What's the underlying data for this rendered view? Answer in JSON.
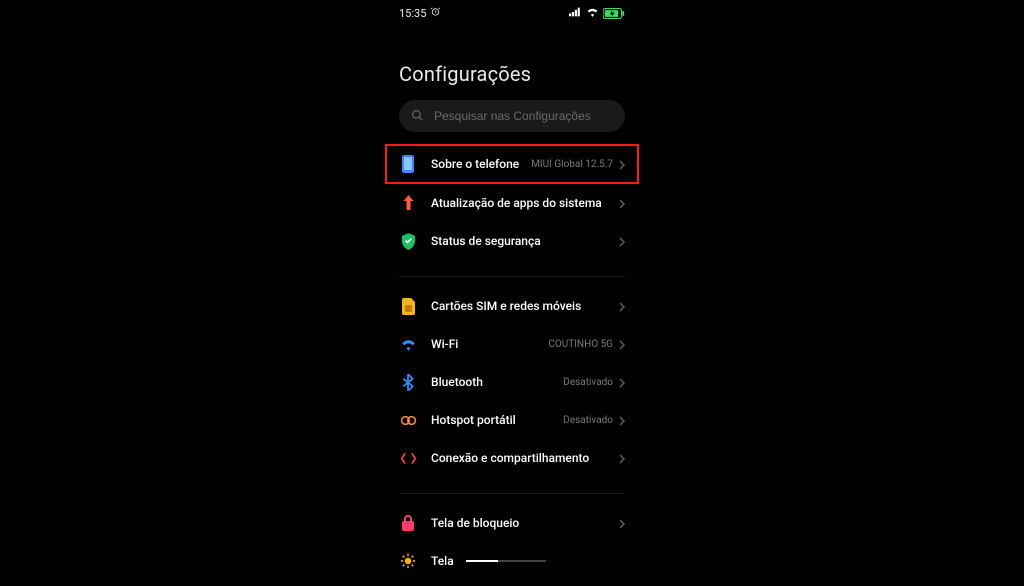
{
  "status": {
    "time": "15:35"
  },
  "page": {
    "title": "Configurações"
  },
  "search": {
    "placeholder": "Pesquisar nas Configurações"
  },
  "items": {
    "about": {
      "label": "Sobre o telefone",
      "value": "MIUI Global 12.5.7"
    },
    "sysapps": {
      "label": "Atualização de apps do sistema"
    },
    "security": {
      "label": "Status de segurança"
    },
    "sim": {
      "label": "Cartões SIM e redes móveis"
    },
    "wifi": {
      "label": "Wi-Fi",
      "value": "COUTINHO 5G"
    },
    "bluetooth": {
      "label": "Bluetooth",
      "value": "Desativado"
    },
    "hotspot": {
      "label": "Hotspot portátil",
      "value": "Desativado"
    },
    "connshare": {
      "label": "Conexão e compartilhamento"
    },
    "lockscreen": {
      "label": "Tela de bloqueio"
    },
    "display": {
      "label": "Tela"
    }
  }
}
